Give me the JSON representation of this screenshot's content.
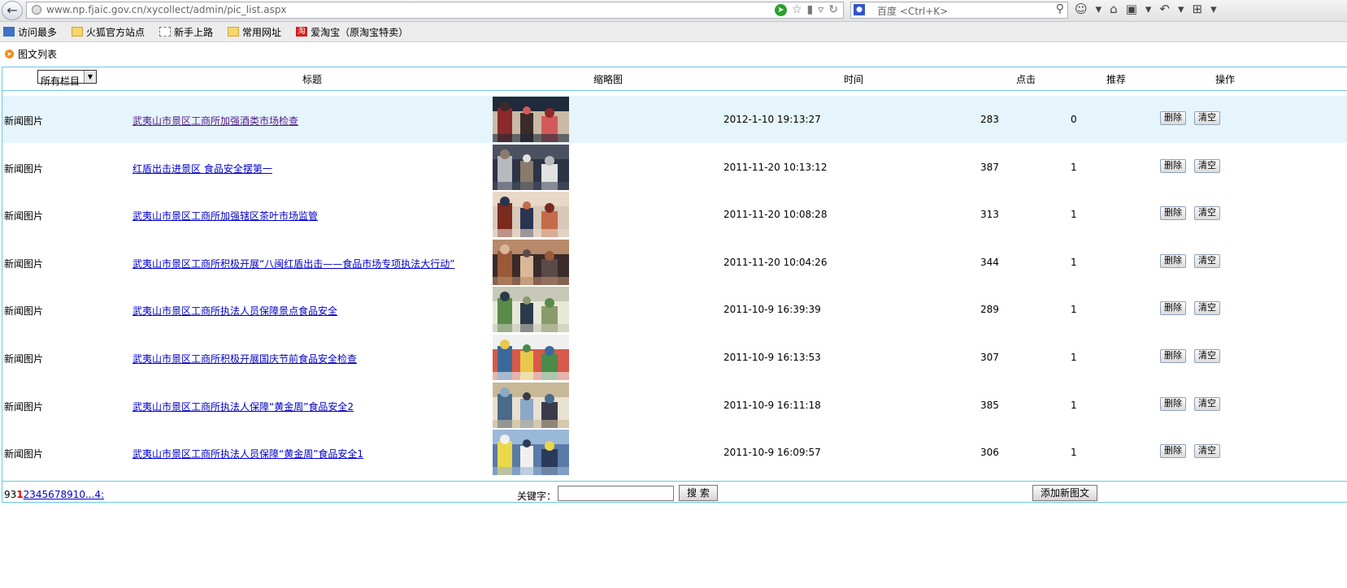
{
  "browser": {
    "url": "www.np.fjaic.gov.cn/xycollect/admin/pic_list.aspx",
    "search_placeholder": "百度 <Ctrl+K>"
  },
  "bookmarks": [
    {
      "label": "访问最多",
      "icon": "most-visited-icon"
    },
    {
      "label": "火狐官方站点",
      "icon": "folder-icon"
    },
    {
      "label": "新手上路",
      "icon": "page-icon"
    },
    {
      "label": "常用网址",
      "icon": "folder-icon"
    },
    {
      "label": "爱淘宝（原淘宝特卖）",
      "icon": "taobao-icon"
    }
  ],
  "page": {
    "heading": "图文列表",
    "category_select": "所有栏目"
  },
  "table": {
    "headers": {
      "title": "标题",
      "thumb": "缩略图",
      "time": "时间",
      "clicks": "点击",
      "recommend": "推荐",
      "action": "操作"
    },
    "rows": [
      {
        "category": "新闻图片",
        "title": "武夷山市景区工商所加强酒类市场检查",
        "time": "2012-1-10 19:13:27",
        "clicks": "283",
        "recommend": "0",
        "palette": [
          "#8a2a2a",
          "#c9b9a5",
          "#3a2a2a",
          "#d35a5a",
          "#1f2a3a"
        ]
      },
      {
        "category": "新闻图片",
        "title": "红盾出击进景区 食品安全摆第一",
        "time": "2011-11-20 10:13:12",
        "clicks": "387",
        "recommend": "1",
        "palette": [
          "#b7b9bf",
          "#2c3446",
          "#8a7a6a",
          "#e1e1e1",
          "#4a5261"
        ]
      },
      {
        "category": "新闻图片",
        "title": "武夷山市景区工商所加强辖区茶叶市场监管",
        "time": "2011-11-20 10:08:28",
        "clicks": "313",
        "recommend": "1",
        "palette": [
          "#7a2a1e",
          "#d8c8b8",
          "#2a3450",
          "#c46a4a",
          "#e8d8c8"
        ]
      },
      {
        "category": "新闻图片",
        "title": "武夷山市景区工商所积极开展“八闽红盾出击——食品市场专项执法大行动”",
        "time": "2011-11-20 10:04:26",
        "clicks": "344",
        "recommend": "1",
        "palette": [
          "#9a5a3a",
          "#3a2a2a",
          "#d8b898",
          "#5a4a4a",
          "#b88a6a"
        ]
      },
      {
        "category": "新闻图片",
        "title": "武夷山市景区工商所执法人员保障景点食品安全",
        "time": "2011-10-9 16:39:39",
        "clicks": "289",
        "recommend": "1",
        "palette": [
          "#5a8a4a",
          "#e8e8d8",
          "#2a3a4a",
          "#8a9a6a",
          "#c8c8b8"
        ]
      },
      {
        "category": "新闻图片",
        "title": "武夷山市景区工商所积极开展国庆节前食品安全检查",
        "time": "2011-10-9 16:13:53",
        "clicks": "307",
        "recommend": "1",
        "palette": [
          "#3a6a9a",
          "#d85a4a",
          "#e8c84a",
          "#4a8a4a",
          "#f0f0f0"
        ]
      },
      {
        "category": "新闻图片",
        "title": "武夷山市景区工商所执法人保障“黄金周”食品安全2",
        "time": "2011-10-9 16:11:18",
        "clicks": "385",
        "recommend": "1",
        "palette": [
          "#4a6a8a",
          "#e8e0d0",
          "#8aa8c8",
          "#3a3a4a",
          "#c8b898"
        ]
      },
      {
        "category": "新闻图片",
        "title": "武夷山市景区工商所执法人员保障“黄金周”食品安全1",
        "time": "2011-10-9 16:09:57",
        "clicks": "306",
        "recommend": "1",
        "palette": [
          "#e8d84a",
          "#5a7aa8",
          "#f0f0f0",
          "#2a3a5a",
          "#9ab8d8"
        ]
      }
    ],
    "delete_label": "删除",
    "clear_label": "清空"
  },
  "footer": {
    "pager_prefix": "93",
    "pager_current": "1",
    "pager_links": "2345678910...4:",
    "keyword_label": "关键字：",
    "search_button": "搜 索",
    "add_button": "添加新图文"
  }
}
